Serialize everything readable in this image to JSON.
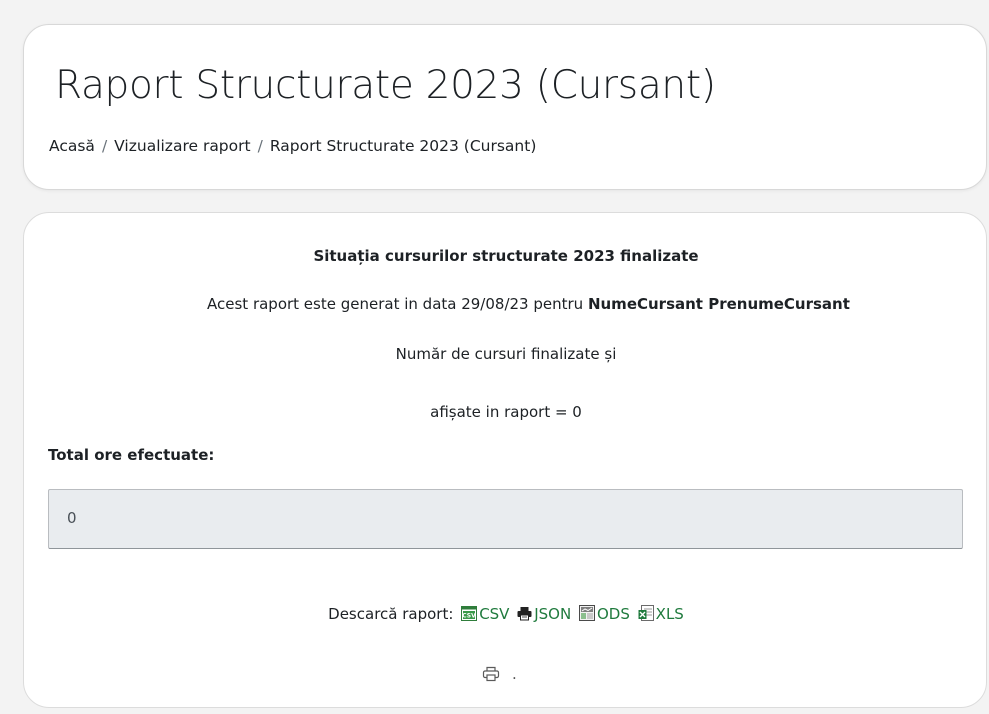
{
  "header": {
    "title": "Raport Structurate 2023 (Cursant)",
    "breadcrumb": [
      {
        "label": "Acasă"
      },
      {
        "label": "Vizualizare raport"
      },
      {
        "label": "Raport Structurate 2023 (Cursant)"
      }
    ],
    "breadcrumb_separator": "/"
  },
  "report": {
    "title": "Situația cursurilor structurate 2023 finalizate",
    "generated_prefix": "Acest raport este generat in data 29/08/23 pentru ",
    "user_name": "NumeCursant PrenumeCursant",
    "count_line1": "Număr de cursuri finalizate și",
    "count_line2": "afișate in raport = 0",
    "total_label": "Total ore efectuate:",
    "total_value": "0"
  },
  "download": {
    "label": "Descarcă raport:",
    "formats": [
      {
        "label": "CSV",
        "icon": "csv-icon"
      },
      {
        "label": "JSON",
        "icon": "printer-icon"
      },
      {
        "label": "ODS",
        "icon": "ods-icon"
      },
      {
        "label": "XLS",
        "icon": "xls-icon"
      }
    ],
    "trailing_dot": "."
  },
  "colors": {
    "background": "#f3f3f3",
    "card": "#ffffff",
    "link_green": "#1f7a3d",
    "input_bg": "#e9ecef",
    "text": "#1d2125"
  }
}
